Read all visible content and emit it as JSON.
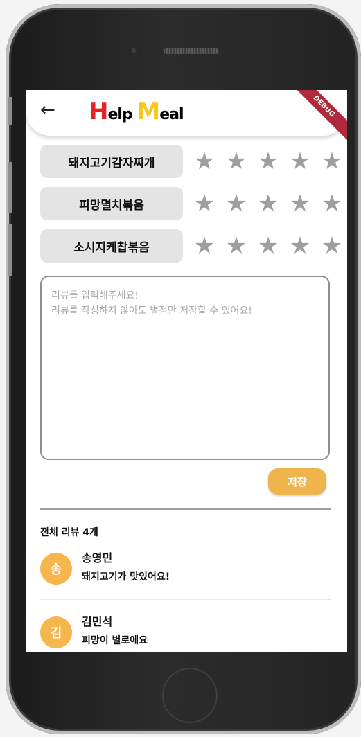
{
  "appbar": {
    "back_icon": "arrow-left-icon",
    "logo_h": "H",
    "logo_elp": "elp",
    "logo_m": "M",
    "logo_eal": "eal",
    "debug_banner": "DEBUG",
    "colors": {
      "logo_red": "#e52321",
      "logo_yellow": "#f7c81f",
      "debug": "#b02a3b"
    }
  },
  "menus": [
    {
      "name": "돼지고기감자찌개",
      "rating": 0
    },
    {
      "name": "피망멸치볶음",
      "rating": 0
    },
    {
      "name": "소시지케찹볶음",
      "rating": 0
    }
  ],
  "review_input": {
    "placeholder": "리뷰를 입력해주세요!\n리뷰를 작성하지 않아도 별점만 저장할 수 있어요!"
  },
  "save_label": "저장",
  "reviews_header": "전체 리뷰 4개",
  "reviews": [
    {
      "initial": "송",
      "name": "송영민",
      "text": "돼지고기가 맛있어요!"
    },
    {
      "initial": "김",
      "name": "김민석",
      "text": "피망이 별로에요"
    }
  ],
  "colors": {
    "accent": "#f0b44c",
    "star_inactive": "#9e9e9e",
    "chip_bg": "#e4e4e4"
  }
}
